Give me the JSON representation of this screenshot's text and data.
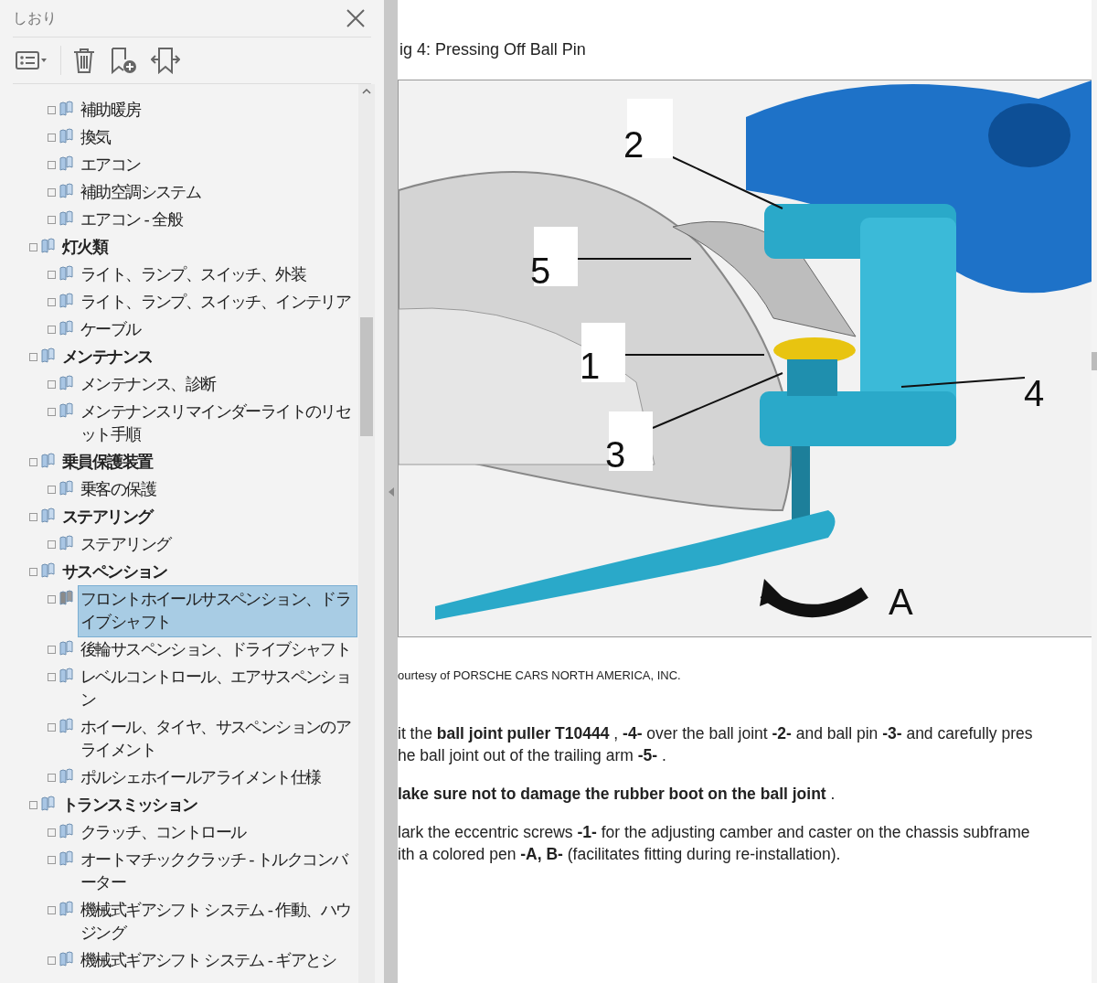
{
  "sidebar": {
    "title": "しおり",
    "tree": {
      "continued_items": [
        {
          "label": "補助暖房",
          "selected": false
        },
        {
          "label": "換気",
          "selected": false
        },
        {
          "label": "エアコン",
          "selected": false
        },
        {
          "label": "補助空調システム",
          "selected": false
        },
        {
          "label": "エアコン - 全般",
          "selected": false
        }
      ],
      "items": [
        {
          "label": "灯火類",
          "selected": false,
          "children": [
            {
              "label": "ライト、ランプ、スイッチ、外装",
              "selected": false
            },
            {
              "label": "ライト、ランプ、スイッチ、インテリア",
              "selected": false
            },
            {
              "label": "ケーブル",
              "selected": false
            }
          ]
        },
        {
          "label": "メンテナンス",
          "selected": false,
          "children": [
            {
              "label": "メンテナンス、診断",
              "selected": false
            },
            {
              "label": "メンテナンスリマインダーライトのリセット手順",
              "selected": false
            }
          ]
        },
        {
          "label": "乗員保護装置",
          "selected": false,
          "children": [
            {
              "label": "乗客の保護",
              "selected": false
            }
          ]
        },
        {
          "label": "ステアリング",
          "selected": false,
          "children": [
            {
              "label": "ステアリング",
              "selected": false
            }
          ]
        },
        {
          "label": "サスペンション",
          "selected": false,
          "children": [
            {
              "label": "フロントホイールサスペンション、ドライブシャフト",
              "selected": true
            },
            {
              "label": "後輪サスペンション、ドライブシャフト",
              "selected": false
            },
            {
              "label": "レベルコントロール、エアサスペンション",
              "selected": false
            },
            {
              "label": "ホイール、タイヤ、サスペンションのアライメント",
              "selected": false
            },
            {
              "label": "ポルシェホイールアライメント仕様",
              "selected": false
            }
          ]
        },
        {
          "label": "トランスミッション",
          "selected": false,
          "children": [
            {
              "label": "クラッチ、コントロール",
              "selected": false
            },
            {
              "label": "オートマチッククラッチ - トルクコンバーター",
              "selected": false
            },
            {
              "label": "機械式ギアシフト システム - 作動、ハウジング",
              "selected": false
            },
            {
              "label": "機械式ギアシフト システム - ギアとシ",
              "selected": false
            }
          ]
        }
      ]
    }
  },
  "document": {
    "figure_title": "ig 4: Pressing Off Ball Pin",
    "callouts": [
      {
        "label": "2"
      },
      {
        "label": "5"
      },
      {
        "label": "1"
      },
      {
        "label": "3"
      },
      {
        "label": "4"
      },
      {
        "label": "A"
      }
    ],
    "credit": "ourtesy of PORSCHE CARS NORTH AMERICA, INC.",
    "paragraphs": [
      {
        "lines": [
          "it the **ball joint puller T10444** , **-4-** over the ball joint **-2-** and ball pin **-3-** and carefully pres",
          "he ball joint out of the trailing arm **-5-** ."
        ]
      },
      {
        "lines": [
          "**lake sure not to damage the rubber boot on the ball joint** ."
        ]
      },
      {
        "lines": [
          "lark the eccentric screws **-1-** for the adjusting camber and caster on the chassis subframe",
          "ith a colored pen **-A, B-** (facilitates fitting during re-installation)."
        ]
      }
    ]
  }
}
